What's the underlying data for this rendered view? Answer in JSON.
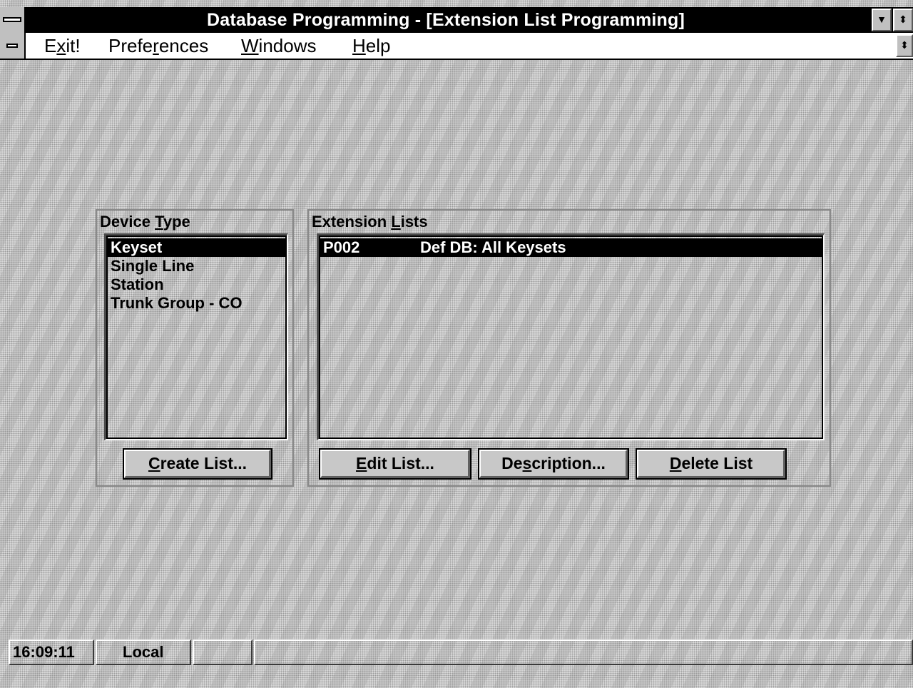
{
  "window": {
    "title": "Database Programming - [Extension List Programming]",
    "min_glyph": "▼",
    "restore_glyph": "⬍"
  },
  "menu": {
    "items": [
      {
        "pre": "E",
        "u": "x",
        "post": "it!"
      },
      {
        "pre": "Prefe",
        "u": "r",
        "post": "ences"
      },
      {
        "pre": "",
        "u": "W",
        "post": "indows"
      },
      {
        "pre": "",
        "u": "H",
        "post": "elp"
      }
    ],
    "restore_glyph": "⬍"
  },
  "device_type": {
    "label_pre": "Device ",
    "label_u": "T",
    "label_post": "ype",
    "items": [
      "Keyset",
      "Single Line",
      "Station",
      "Trunk Group - CO"
    ],
    "selected_index": 0,
    "create_button": {
      "pre": "",
      "u": "C",
      "post": "reate List..."
    }
  },
  "extension_lists": {
    "label_pre": "Extension ",
    "label_u": "L",
    "label_post": "ists",
    "rows": [
      {
        "code": "P002",
        "description": "Def DB: All Keysets"
      }
    ],
    "selected_index": 0,
    "buttons": {
      "edit": {
        "pre": "",
        "u": "E",
        "post": "dit List..."
      },
      "description": {
        "pre": "De",
        "u": "s",
        "post": "cription..."
      },
      "delete": {
        "pre": "",
        "u": "D",
        "post": "elete List"
      }
    }
  },
  "status": {
    "time": "16:09:11",
    "mode": "Local",
    "cell3": "",
    "cell4": ""
  },
  "colors": {
    "titlebar": "#000000",
    "background": "#d4d4d4",
    "selection": "#000000"
  }
}
